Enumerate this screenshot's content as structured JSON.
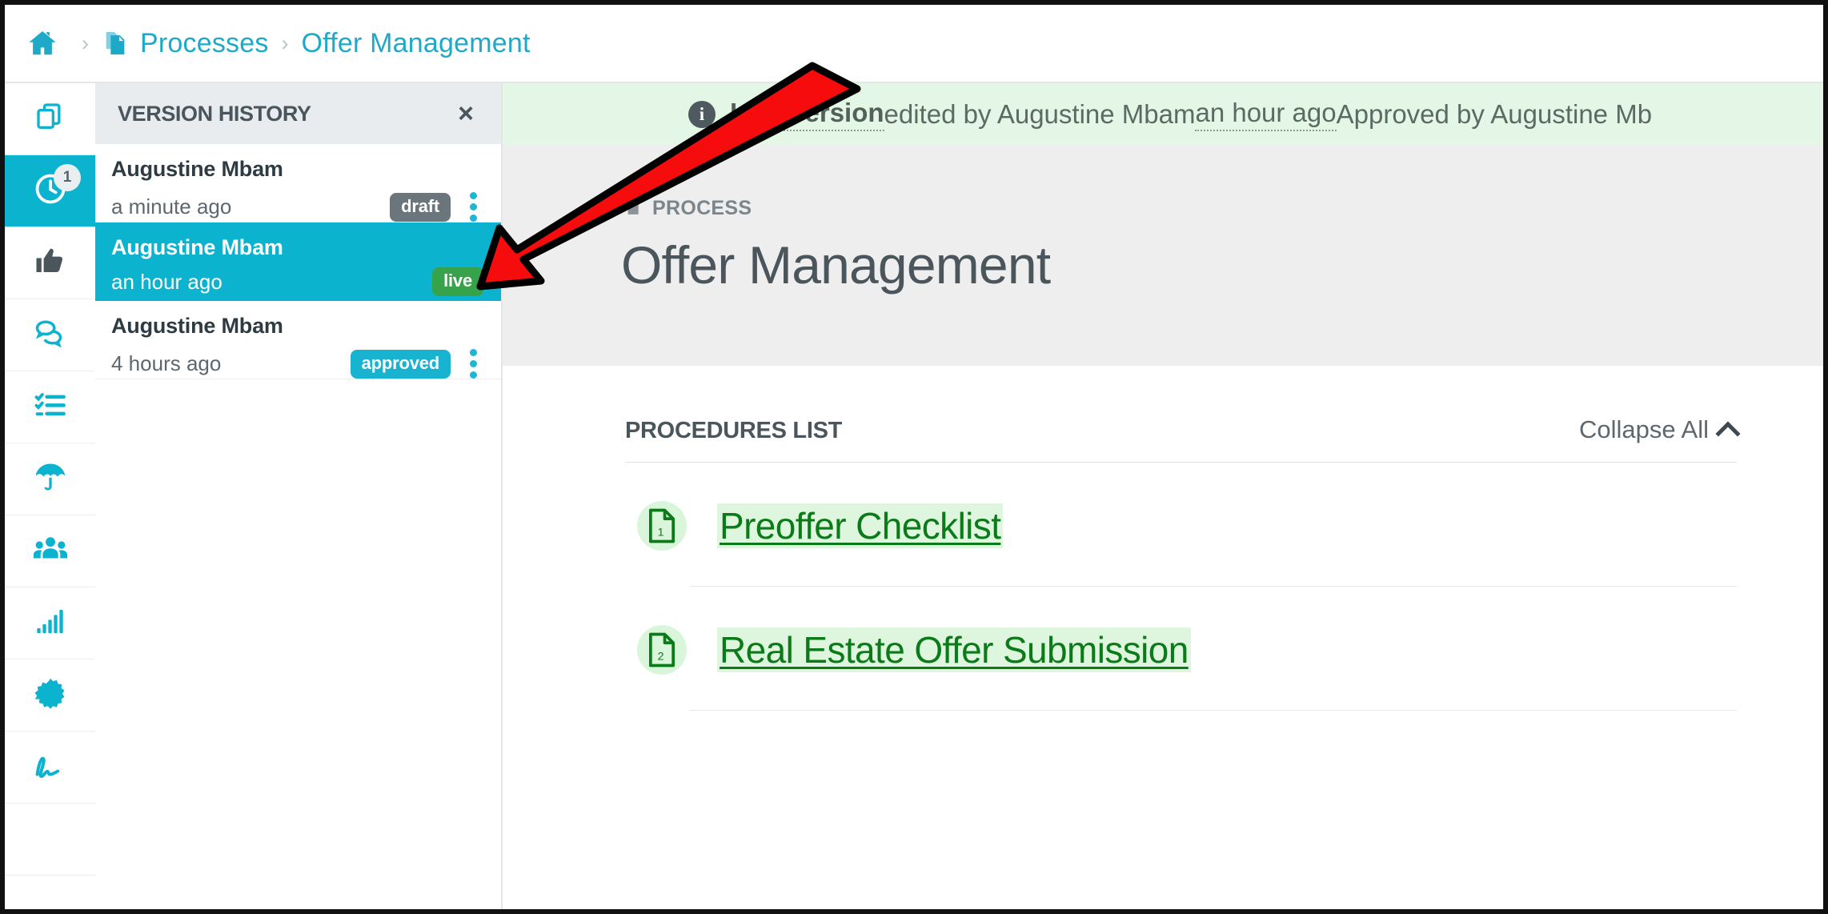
{
  "breadcrumb": {
    "home_icon": "home-icon",
    "items": [
      {
        "label": "Processes",
        "icon": "process-copy-icon"
      },
      {
        "label": "Offer Management",
        "icon": null
      }
    ],
    "separator": "›"
  },
  "rail": {
    "items": [
      {
        "name": "documents",
        "icon": "copy-documents-icon",
        "active": false,
        "badge": null
      },
      {
        "name": "version-history",
        "icon": "clock-icon",
        "active": true,
        "badge": "1"
      },
      {
        "name": "endorsements",
        "icon": "thumbs-up-icon",
        "active": false,
        "badge": null
      },
      {
        "name": "comments",
        "icon": "chat-bubbles-icon",
        "active": false,
        "badge": null
      },
      {
        "name": "tasks",
        "icon": "checklist-icon",
        "active": false,
        "badge": null
      },
      {
        "name": "risk",
        "icon": "umbrella-icon",
        "active": false,
        "badge": null
      },
      {
        "name": "teams",
        "icon": "people-group-icon",
        "active": false,
        "badge": null
      },
      {
        "name": "analytics",
        "icon": "bar-chart-icon",
        "active": false,
        "badge": null
      },
      {
        "name": "certification",
        "icon": "starburst-icon",
        "active": false,
        "badge": null
      },
      {
        "name": "signature",
        "icon": "signature-icon",
        "active": false,
        "badge": null
      }
    ]
  },
  "version_history": {
    "title": "VERSION HISTORY",
    "close_label": "×",
    "rows": [
      {
        "author": "Augustine Mbam",
        "time": "a minute ago",
        "badge": "draft",
        "badge_kind": "draft",
        "selected": false,
        "has_menu": true
      },
      {
        "author": "Augustine Mbam",
        "time": "an hour ago",
        "badge": "live",
        "badge_kind": "live",
        "selected": true,
        "has_menu": false
      },
      {
        "author": "Augustine Mbam",
        "time": "4 hours ago",
        "badge": "approved",
        "badge_kind": "approved",
        "selected": false,
        "has_menu": true
      }
    ]
  },
  "banner": {
    "info_icon": "info-icon",
    "live_version_label": "Live version",
    "edited_by_text": " edited by Augustine Mbam ",
    "time_label": "an hour ago",
    "approved_text": "  Approved by Augustine Mb"
  },
  "document": {
    "kicker_icon": "process-copy-icon",
    "kicker": "PROCESS",
    "title": "Offer Management"
  },
  "procedures": {
    "section_title": "PROCEDURES LIST",
    "collapse_label": "Collapse All",
    "collapse_icon": "chevron-up-icon",
    "items": [
      {
        "number": "1",
        "label": "Preoffer Checklist",
        "icon": "document-icon"
      },
      {
        "number": "2",
        "label": "Real Estate Offer Submission",
        "icon": "document-icon"
      }
    ]
  },
  "annotation": {
    "arrow_icon": "red-pointer-arrow",
    "color": "#f60c0c"
  },
  "colors": {
    "accent_teal": "#0cb3cf",
    "breadcrumb_blue": "#1fa9c9",
    "banner_green_bg": "#e4f6e6",
    "link_green": "#0b7a18",
    "badge_live": "#36a24a",
    "badge_draft": "#6b767c",
    "badge_approved": "#19b3d2",
    "header_gray": "#eeeeee"
  }
}
